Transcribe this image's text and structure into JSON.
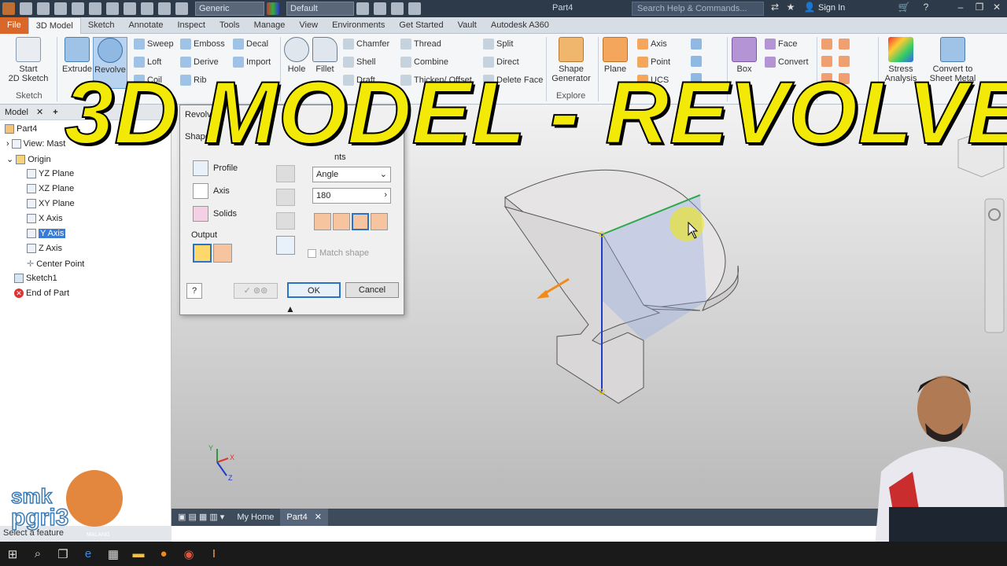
{
  "titlebar": {
    "material": "Generic",
    "appearance": "Default",
    "document": "Part4",
    "search_placeholder": "Search Help & Commands...",
    "sign_in": "Sign In"
  },
  "tabs": [
    "File",
    "3D Model",
    "Sketch",
    "Annotate",
    "Inspect",
    "Tools",
    "Manage",
    "View",
    "Environments",
    "Get Started",
    "Vault",
    "Autodesk A360"
  ],
  "ribbon": {
    "start_sketch": "Start\n2D Sketch",
    "sketch_group": "Sketch",
    "extrude": "Extrude",
    "revolve": "Revolve",
    "sweep": "Sweep",
    "loft": "Loft",
    "coil": "Coil",
    "emboss": "Emboss",
    "derive": "Derive",
    "rib": "Rib",
    "decal": "Decal",
    "import": "Import",
    "hole": "Hole",
    "fillet": "Fillet",
    "chamfer": "Chamfer",
    "shell": "Shell",
    "draft": "Draft",
    "thread": "Thread",
    "combine": "Combine",
    "thicken": "Thicken/ Offset",
    "split": "Split",
    "direct": "Direct",
    "delete_face": "Delete Face",
    "shape_generator": "Shape\nGenerator",
    "explore": "Explore",
    "plane": "Plane",
    "axis": "Axis",
    "point": "Point",
    "ucs": "UCS",
    "box": "Box",
    "face": "Face",
    "convert": "Convert",
    "stress": "Stress\nAnalysis",
    "convert_sheet": "Convert to\nSheet Metal"
  },
  "browser": {
    "tab_model": "Model",
    "items": [
      "Part4",
      "View: Mast",
      "Origin",
      "YZ Plane",
      "XZ Plane",
      "XY Plane",
      "X Axis",
      "Y Axis",
      "Z Axis",
      "Center Point",
      "Sketch1",
      "End of Part"
    ]
  },
  "dialog": {
    "title": "Revolve",
    "shape_label": "Shape",
    "profile": "Profile",
    "axis": "Axis",
    "solids": "Solids",
    "output": "Output",
    "extents_label": "nts",
    "extents_type": "Angle",
    "angle_value": "180",
    "match_shape": "Match shape",
    "ok": "OK",
    "cancel": "Cancel"
  },
  "doc_tabs": [
    "My Home",
    "Part4"
  ],
  "status": "Select a feature",
  "overlay_title": "3D MODEL - REVOLVE",
  "logo": {
    "text": "smk pgri3",
    "tagline": "MALANG"
  },
  "colors": {
    "accent": "#2a73c9",
    "file_tab": "#d9672a",
    "overlay": "#f2ea06"
  }
}
